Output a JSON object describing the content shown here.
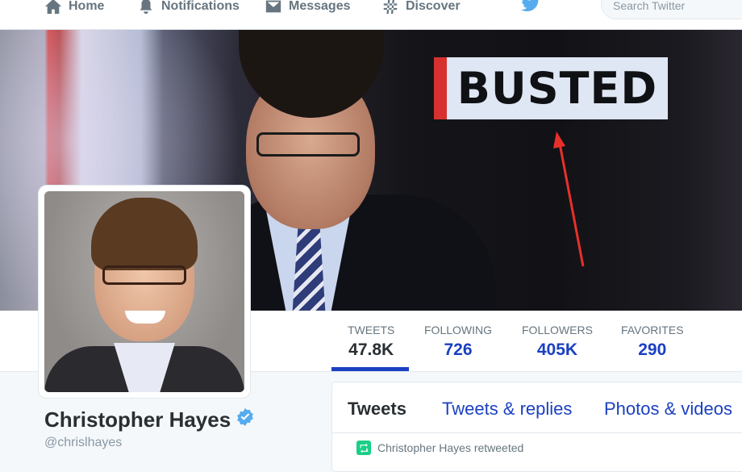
{
  "topnav": {
    "items": [
      {
        "label": "Home",
        "icon": "home-icon"
      },
      {
        "label": "Notifications",
        "icon": "bell-icon"
      },
      {
        "label": "Messages",
        "icon": "envelope-icon"
      },
      {
        "label": "Discover",
        "icon": "hashtag-icon"
      }
    ],
    "logo_icon": "twitter-bird-icon",
    "search_placeholder": "Search Twitter"
  },
  "header": {
    "sign_text": "BUSTED",
    "annotation": "red-arrow"
  },
  "profile": {
    "name": "Christopher Hayes",
    "screen_name": "@chrislhayes",
    "verified_icon": "verified-badge-icon"
  },
  "stats": [
    {
      "label": "TWEETS",
      "value": "47.8K"
    },
    {
      "label": "FOLLOWING",
      "value": "726"
    },
    {
      "label": "FOLLOWERS",
      "value": "405K"
    },
    {
      "label": "FAVORITES",
      "value": "290"
    }
  ],
  "timeline": {
    "tabs": [
      "Tweets",
      "Tweets & replies",
      "Photos & videos"
    ],
    "retweet_context": "Christopher Hayes retweeted",
    "retweet_icon": "retweet-icon"
  },
  "colors": {
    "link_blue": "#1b40c2",
    "twitter_blue": "#55acee",
    "retweet_green": "#19cf86",
    "annotation_red": "#e8302a"
  }
}
